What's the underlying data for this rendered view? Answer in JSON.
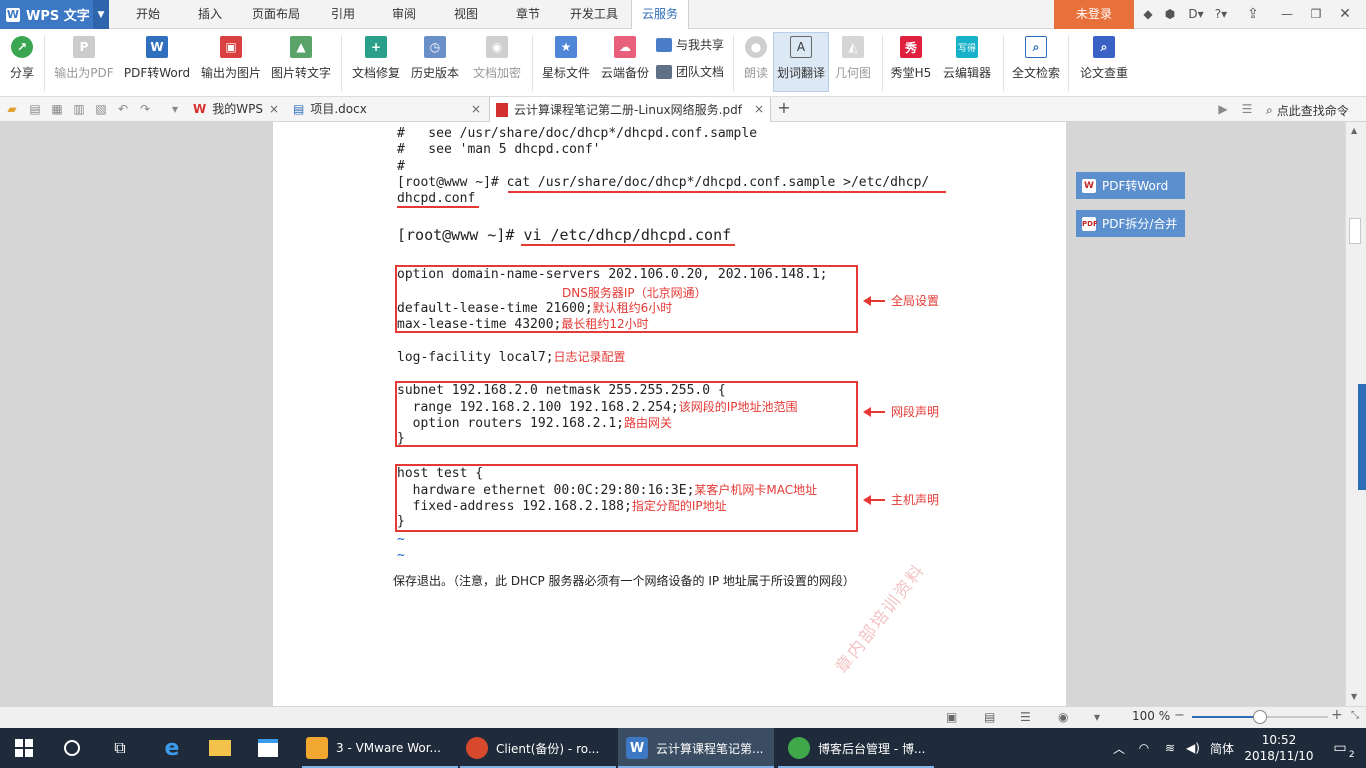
{
  "app": {
    "name": "WPS 文字",
    "logo_letter": "W",
    "menu_arrow": "▼"
  },
  "menu_tabs": [
    {
      "label": "开始",
      "active": false
    },
    {
      "label": "插入",
      "active": false
    },
    {
      "label": "页面布局",
      "active": false
    },
    {
      "label": "引用",
      "active": false
    },
    {
      "label": "审阅",
      "active": false
    },
    {
      "label": "视图",
      "active": false
    },
    {
      "label": "章节",
      "active": false
    },
    {
      "label": "开发工具",
      "active": false
    },
    {
      "label": "云服务",
      "active": true
    }
  ],
  "title_right": {
    "login": "未登录"
  },
  "ribbon": {
    "share": "分享",
    "export_pdf": "输出为PDF",
    "pdf_to_word": "PDF转Word",
    "export_image": "输出为图片",
    "image_to_text": "图片转文字",
    "doc_repair": "文档修复",
    "history": "历史版本",
    "doc_encrypt": "文档加密",
    "star_files": "星标文件",
    "cloud_backup": "云端备份",
    "share_with_me": "与我共享",
    "team_docs": "团队文档",
    "read_aloud": "朗读",
    "translate": "划词翻译",
    "geometry": "几何图",
    "xiutang": "秀堂H5",
    "cloud_editor": "云编辑器",
    "fulltext_search": "全文检索",
    "paper_check": "论文查重",
    "icon_text": {
      "xiu": "秀",
      "xiede": "写得"
    }
  },
  "doc_tabs": [
    {
      "label": "我的WPS",
      "active": false
    },
    {
      "label": "项目.docx",
      "active": false
    },
    {
      "label": "云计算课程笔记第二册-Linux网络服务.pdf",
      "active": true
    }
  ],
  "tab_bar_right": {
    "search": "点此查找命令"
  },
  "document": {
    "lines_top": [
      "#   see /usr/share/doc/dhcp*/dhcpd.conf.sample",
      "#   see 'man 5 dhcpd.conf'",
      "#"
    ],
    "cat_prompt": "[root@www ~]# ",
    "cat_cmd1": "cat /usr/share/doc/dhcp*/dhcpd.conf.sample >/etc/dhcp/",
    "cat_cmd2": "dhcpd.conf",
    "vi_prompt": "[root@www ~]# ",
    "vi_cmd": "vi /etc/dhcp/dhcpd.conf",
    "global": {
      "line1": "option domain-name-servers 202.106.0.20, 202.106.148.1;",
      "note_dns": "DNS服务器IP（北京网通）",
      "line2": "default-lease-time 21600;",
      "note2": "默认租约6小时",
      "line3": "max-lease-time 43200;",
      "note3": "最长租约12小时",
      "label": "全局设置"
    },
    "log": {
      "line": "log-facility local7;",
      "note": "日志记录配置"
    },
    "subnet": {
      "line1": "subnet 192.168.2.0 netmask 255.255.255.0 {",
      "line2": "  range 192.168.2.100 192.168.2.254;",
      "note2": "该网段的IP地址池范围",
      "line3": "  option routers 192.168.2.1;",
      "note3": "路由网关",
      "line4": "}",
      "label": "网段声明"
    },
    "host": {
      "line1": "host test {",
      "line2": "  hardware ethernet 00:0C:29:80:16:3E;",
      "note2": "某客户机网卡MAC地址",
      "line3": "  fixed-address 192.168.2.188;",
      "note3": "指定分配的IP地址",
      "line4": "}",
      "label": "主机声明"
    },
    "tilde": "~",
    "footer_text": "保存退出。（注意，此 DHCP 服务器必须有一个网络设备的 IP 地址属于所设置的网段）",
    "watermark": "章内部培训资料"
  },
  "side_panel": {
    "pdf_to_word": "PDF转Word",
    "pdf_split": "PDF拆分/合并",
    "pdf_tag": "PDF"
  },
  "statusbar": {
    "zoom": "100 %",
    "zoom_level": 0.5
  },
  "taskbar": {
    "items": [
      {
        "label": "3 - VMware Wor...",
        "active": false
      },
      {
        "label": "Client(备份)  - ro...",
        "active": false
      },
      {
        "label": "云计算课程笔记第...",
        "active": true
      },
      {
        "label": "博客后台管理 - 博...",
        "active": false
      }
    ],
    "ime": "简体",
    "time": "10:52",
    "date": "2018/11/10",
    "notif_count": "2"
  }
}
